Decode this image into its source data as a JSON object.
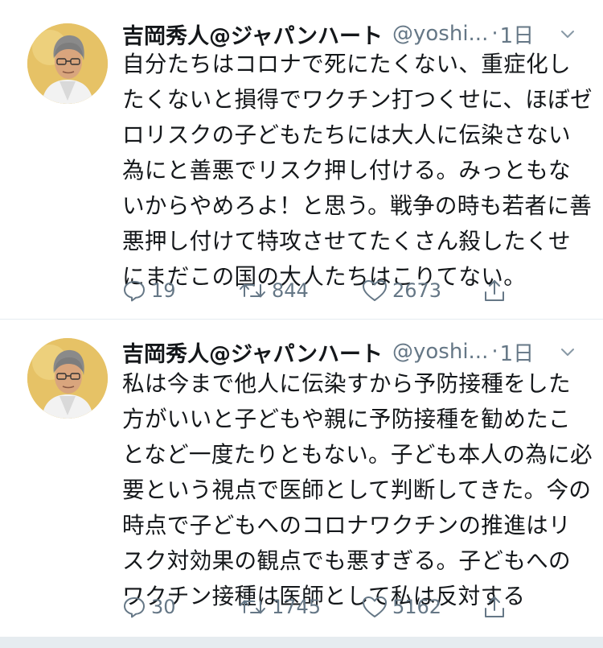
{
  "tweets": [
    {
      "author_name": "吉岡秀人@ジャパンハート",
      "handle": "@yoshi...",
      "separator": "·",
      "time": "1日",
      "text": "自分たちはコロナで死にたくない、重症化したくないと損得でワクチン打つくせに、ほぼゼロリスクの子どもたちには大人に伝染さない為にと善悪でリスク押し付ける。みっともないからやめろよ！と思う。戦争の時も若者に善悪押し付けて特攻させてたくさん殺したくせにまだこの国の大人たちはこりてない。",
      "replies": "19",
      "retweets": "844",
      "likes": "2673"
    },
    {
      "author_name": "吉岡秀人@ジャパンハート",
      "handle": "@yoshi...",
      "separator": "·",
      "time": "1日",
      "text": "私は今まで他人に伝染すから予防接種をした方がいいと子どもや親に予防接種を勧めたことなど一度たりともない。子ども本人の為に必要という視点で医師として判断してきた。今の時点で子どもへのコロナワクチンの推進はリスク対効果の観点でも悪すぎる。子どもへのワクチン接種は医師として私は反対する",
      "replies": "30",
      "retweets": "1745",
      "likes": "5162"
    }
  ],
  "icons": {
    "reply": "reply-icon",
    "retweet": "retweet-icon",
    "like": "heart-icon",
    "share": "share-icon",
    "caret": "chevron-down-icon"
  },
  "colors": {
    "text": "#14171a",
    "secondary": "#657786",
    "divider": "#e6ecf0",
    "avatar_bg": "#e9c96a"
  }
}
